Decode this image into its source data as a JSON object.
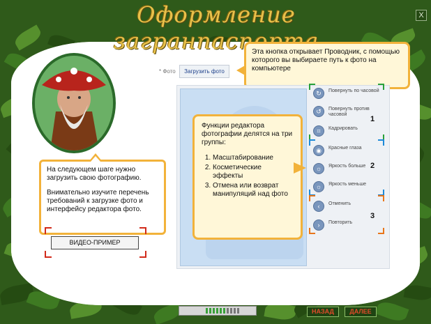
{
  "header": {
    "title": "Оформление загранпаспорта",
    "close_glyph": "X"
  },
  "left_panel": {
    "bubble_p1": "На следующем шаге нужно загрузить свою фотографию.",
    "bubble_p2": "Внимательно изучите перечень требований к загрузке фото и интерфейсу редактора фото.",
    "video_button": "ВИДЕО-ПРИМЕР"
  },
  "upload": {
    "label": "* Фото",
    "button": "Загрузить фото"
  },
  "top_hint": "Эта кнопка открывает Проводник, с помощью которого вы выбираете путь к фото на компьютере",
  "center_hint": {
    "intro": "Функции редактора фотографии делятся на три группы:",
    "items": [
      "Масштабирование",
      "Косметические эффекты",
      "Отмена или возврат манипуляций над фото"
    ]
  },
  "tools": [
    {
      "label": "Повернуть по часовой",
      "icon": "rotate-cw-icon",
      "glyph": "↻"
    },
    {
      "label": "Повернуть против часовой",
      "icon": "rotate-ccw-icon",
      "glyph": "↺"
    },
    {
      "label": "Кадрировать",
      "icon": "crop-icon",
      "glyph": "⌗"
    },
    {
      "label": "Красные глаза",
      "icon": "red-eye-icon",
      "glyph": "◉"
    },
    {
      "label": "Яркость больше",
      "icon": "brightness-up-icon",
      "glyph": "☼"
    },
    {
      "label": "Яркость меньше",
      "icon": "brightness-down-icon",
      "glyph": "☼"
    },
    {
      "label": "Отменить",
      "icon": "undo-icon",
      "glyph": "‹"
    },
    {
      "label": "Повторить",
      "icon": "redo-icon",
      "glyph": "›"
    }
  ],
  "group_numbers": [
    "1",
    "2",
    "3"
  ],
  "navigation": {
    "back": "НАЗАД",
    "next": "ДАЛЕЕ"
  },
  "progress": {
    "completed_steps": 6,
    "total_steps": 10
  },
  "colors": {
    "accent_orange": "#f2b23a",
    "title_gold": "#e8c14a",
    "nav_text": "#e04a2a",
    "background_green": "#2f5a1a"
  }
}
